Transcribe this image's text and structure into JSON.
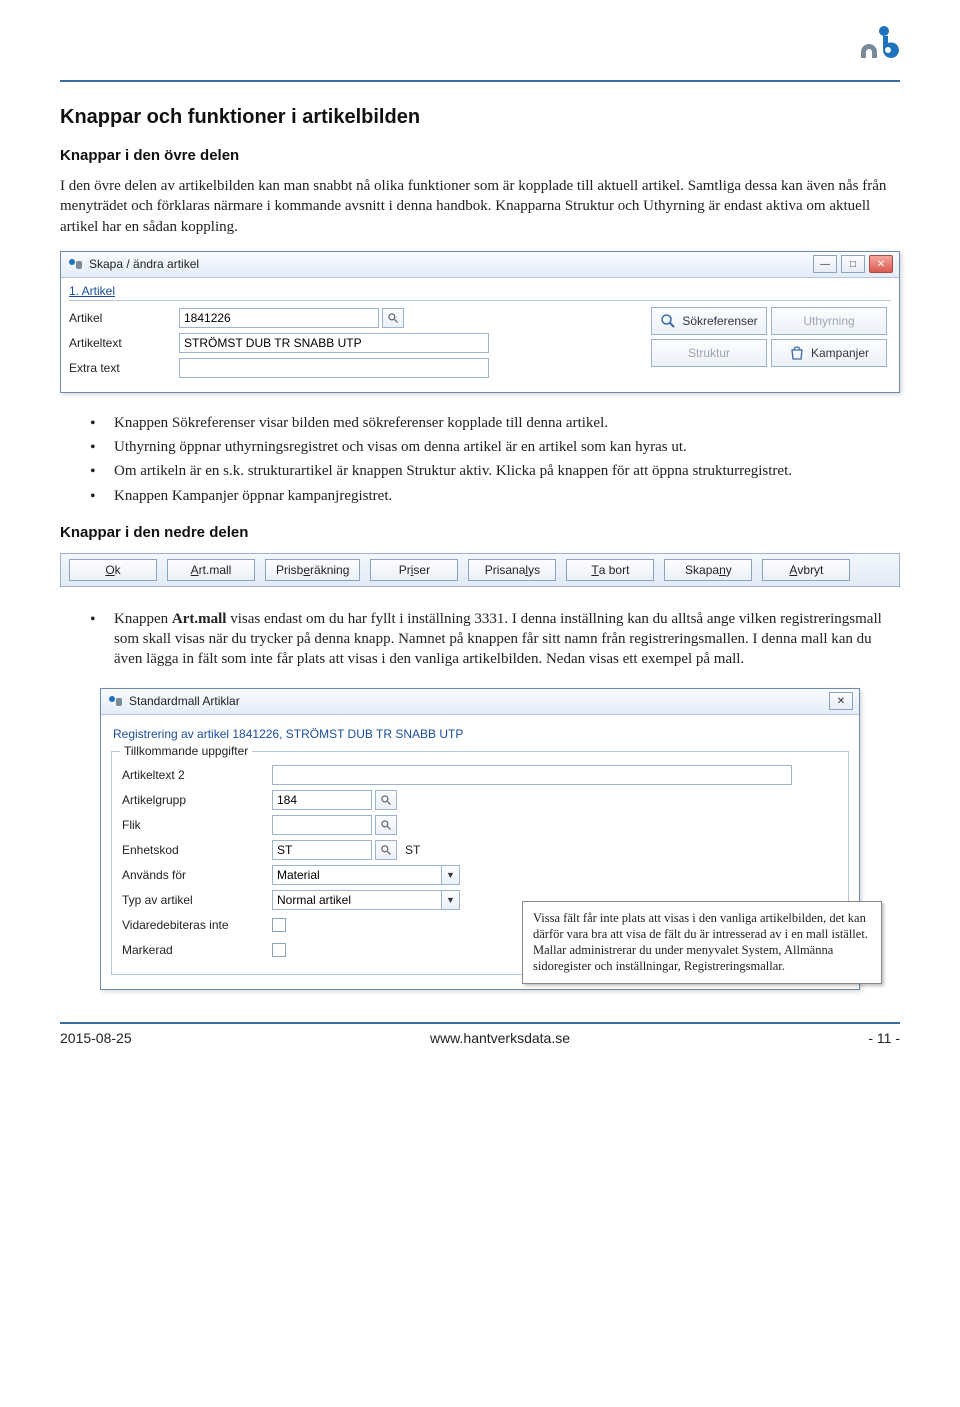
{
  "header": {
    "logo_alt": "ab logo"
  },
  "h1": "Knappar och funktioner i artikelbilden",
  "sec1": {
    "heading": "Knappar i den övre delen",
    "para": "I den övre delen av artikelbilden kan man snabbt nå olika funktioner som är kopplade till aktuell artikel. Samtliga dessa kan även nås från menyträdet och förklaras närmare i kommande avsnitt i denna handbok. Knapparna Struktur och Uthyrning är endast aktiva om aktuell artikel har en sådan koppling."
  },
  "win1": {
    "title": "Skapa / ändra artikel",
    "section": "1. Artikel",
    "labels": {
      "artikel": "Artikel",
      "artikeltext": "Artikeltext",
      "extratext": "Extra text"
    },
    "values": {
      "artikel": "1841226",
      "artikeltext": "STRÖMST DUB TR SNABB UTP",
      "extratext": ""
    },
    "buttons": {
      "sokreferenser": "Sökreferenser",
      "uthyrning": "Uthyrning",
      "struktur": "Struktur",
      "kampanjer": "Kampanjer"
    },
    "winbtns": {
      "min": "—",
      "max": "□",
      "close": "✕"
    }
  },
  "bullets1": [
    "Knappen Sökreferenser visar bilden med sökreferenser kopplade till denna artikel.",
    "Uthyrning öppnar uthyrningsregistret och visas om denna artikel är en artikel som kan hyras ut.",
    "Om artikeln är en s.k. strukturartikel är knappen Struktur aktiv. Klicka på knappen för att öppna strukturregistret.",
    "Knappen Kampanjer öppnar kampanjregistret."
  ],
  "sec2": {
    "heading": "Knappar i den nedre delen"
  },
  "btnbar": {
    "ok": {
      "pre": "",
      "u": "O",
      "post": "k"
    },
    "artmall": {
      "pre": "",
      "u": "A",
      "post": "rt.mall"
    },
    "prisber": {
      "pre": "Prisb",
      "u": "e",
      "post": "räkning"
    },
    "priser": {
      "pre": "Pr",
      "u": "i",
      "post": "ser"
    },
    "prisana": {
      "pre": "Prisana",
      "u": "l",
      "post": "ys"
    },
    "tabort": {
      "pre": "",
      "u": "T",
      "post": "a bort"
    },
    "skapany": {
      "pre": "Skapa ",
      "u": "n",
      "post": "y"
    },
    "avbryt": {
      "pre": "",
      "u": "A",
      "post": "vbryt"
    }
  },
  "bullet2_prefix": "Knappen ",
  "bullet2_bold": "Art.mall",
  "bullet2_rest": " visas endast om du har fyllt i inställning 3331. I denna inställning kan du alltså ange vilken registreringsmall som skall visas när du trycker på denna knapp. Namnet på knappen får sitt namn från registreringsmallen. I denna mall kan du även lägga in fält som inte får plats att visas i den vanliga artikelbilden. Nedan visas ett exempel på mall.",
  "win2": {
    "title": "Standardmall Artiklar",
    "close": "✕",
    "line": "Registrering av artikel 1841226, STRÖMST DUB TR SNABB UTP",
    "legend": "Tillkommande uppgifter",
    "labels": {
      "artikeltext2": "Artikeltext 2",
      "artikelgrupp": "Artikelgrupp",
      "flik": "Flik",
      "enhetskod": "Enhetskod",
      "anvandsfor": "Används för",
      "typ": "Typ av artikel",
      "vidare": "Vidaredebiteras inte",
      "markerad": "Markerad"
    },
    "values": {
      "artikeltext2": "",
      "artikelgrupp": "184",
      "flik": "",
      "enhetskod": "ST",
      "enhetskod_suffix": "ST",
      "anvandsfor": "Material",
      "typ": "Normal artikel"
    }
  },
  "callout": "Vissa fält får inte plats att visas i den vanliga artikelbilden, det kan därför vara bra att visa de fält du är intresserad av i en mall istället. Mallar administrerar du under menyvalet System, Allmänna sidoregister och inställningar, Registreringsmallar.",
  "footer": {
    "date": "2015-08-25",
    "url": "www.hantverksdata.se",
    "page": "- 11 -"
  }
}
